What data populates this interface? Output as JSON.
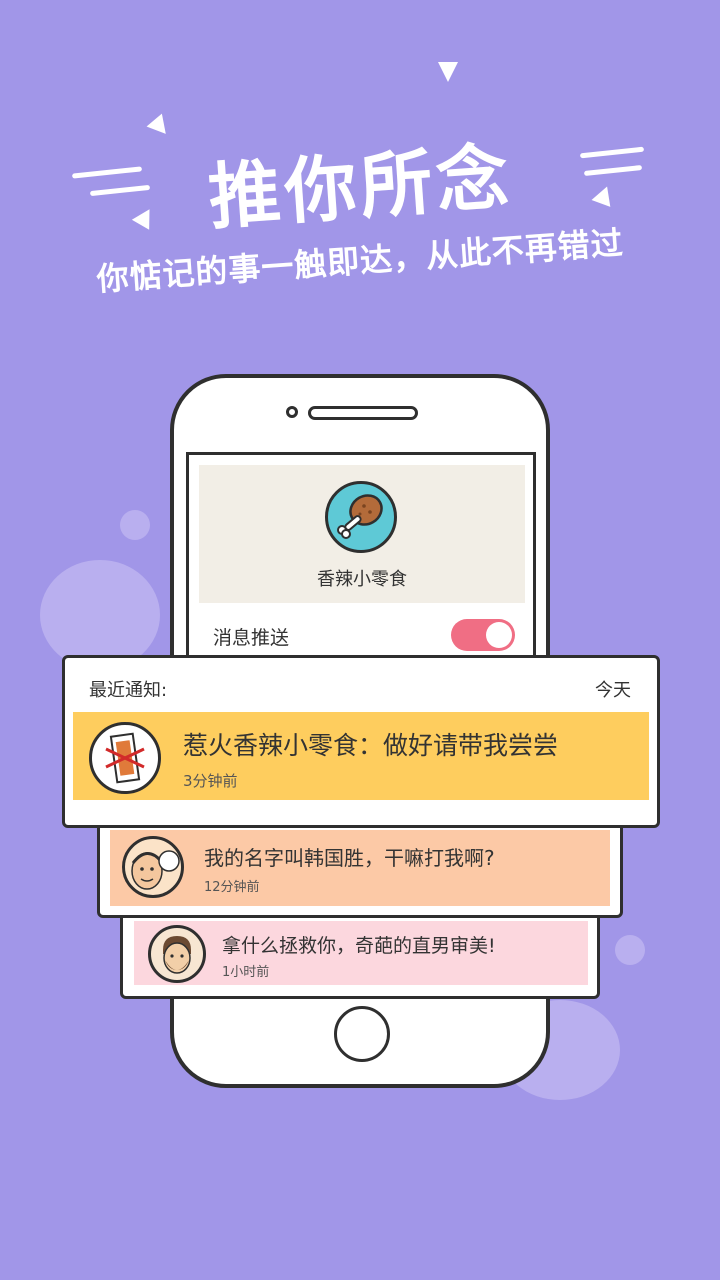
{
  "banner": {
    "headline": "推你所念",
    "subline": "你惦记的事一触即达，从此不再错过"
  },
  "phone": {
    "app_name": "香辣小零食",
    "push_label": "消息推送",
    "push_enabled": true
  },
  "notifications_card": {
    "title": "最近通知:",
    "date_label": "今天",
    "items": [
      {
        "text": "惹火香辣小零食：做好请带我尝尝",
        "time": "3分钟前",
        "bg": "#fecd5e"
      },
      {
        "text": "我的名字叫韩国胜，干嘛打我啊?",
        "time": "12分钟前",
        "bg": "#fcc9a6"
      },
      {
        "text": "拿什么拯救你，奇葩的直男审美!",
        "time": "1小时前",
        "bg": "#fcd7de"
      }
    ]
  },
  "colors": {
    "background": "#a196e8",
    "toggle": "#f06e84",
    "app_icon_bg": "#5ec9d6"
  }
}
